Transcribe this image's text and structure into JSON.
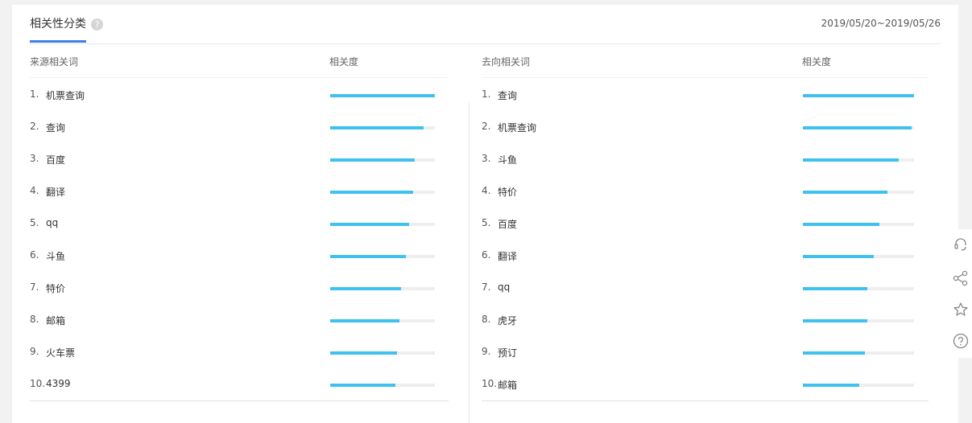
{
  "header": {
    "title": "相关性分类",
    "help_icon": "?",
    "date_range": "2019/05/20~2019/05/26"
  },
  "left_table": {
    "col_name": "来源相关词",
    "col_relevance": "相关度",
    "rows": [
      {
        "idx": "1.",
        "word": "机票查询",
        "value": 1.0
      },
      {
        "idx": "2.",
        "word": "查询",
        "value": 0.89
      },
      {
        "idx": "3.",
        "word": "百度",
        "value": 0.81
      },
      {
        "idx": "4.",
        "word": "翻译",
        "value": 0.79
      },
      {
        "idx": "5.",
        "word": "qq",
        "value": 0.75
      },
      {
        "idx": "6.",
        "word": "斗鱼",
        "value": 0.72
      },
      {
        "idx": "7.",
        "word": "特价",
        "value": 0.68
      },
      {
        "idx": "8.",
        "word": "邮箱",
        "value": 0.66
      },
      {
        "idx": "9.",
        "word": "火车票",
        "value": 0.64
      },
      {
        "idx": "10.",
        "word": "4399",
        "value": 0.62
      }
    ]
  },
  "right_table": {
    "col_name": "去向相关词",
    "col_relevance": "相关度",
    "rows": [
      {
        "idx": "1.",
        "word": "查询",
        "value": 1.0
      },
      {
        "idx": "2.",
        "word": "机票查询",
        "value": 0.98
      },
      {
        "idx": "3.",
        "word": "斗鱼",
        "value": 0.86
      },
      {
        "idx": "4.",
        "word": "特价",
        "value": 0.76
      },
      {
        "idx": "5.",
        "word": "百度",
        "value": 0.69
      },
      {
        "idx": "6.",
        "word": "翻译",
        "value": 0.64
      },
      {
        "idx": "7.",
        "word": "qq",
        "value": 0.58
      },
      {
        "idx": "8.",
        "word": "虎牙",
        "value": 0.58
      },
      {
        "idx": "9.",
        "word": "预订",
        "value": 0.56
      },
      {
        "idx": "10.",
        "word": "邮箱",
        "value": 0.51
      }
    ]
  },
  "colors": {
    "bar_fill": "#3fc1f0",
    "bar_track": "#eeeeee",
    "tab_underline": "#3d7ee6"
  },
  "side_tools": [
    "headset-icon",
    "share-icon",
    "star-icon",
    "question-icon"
  ]
}
